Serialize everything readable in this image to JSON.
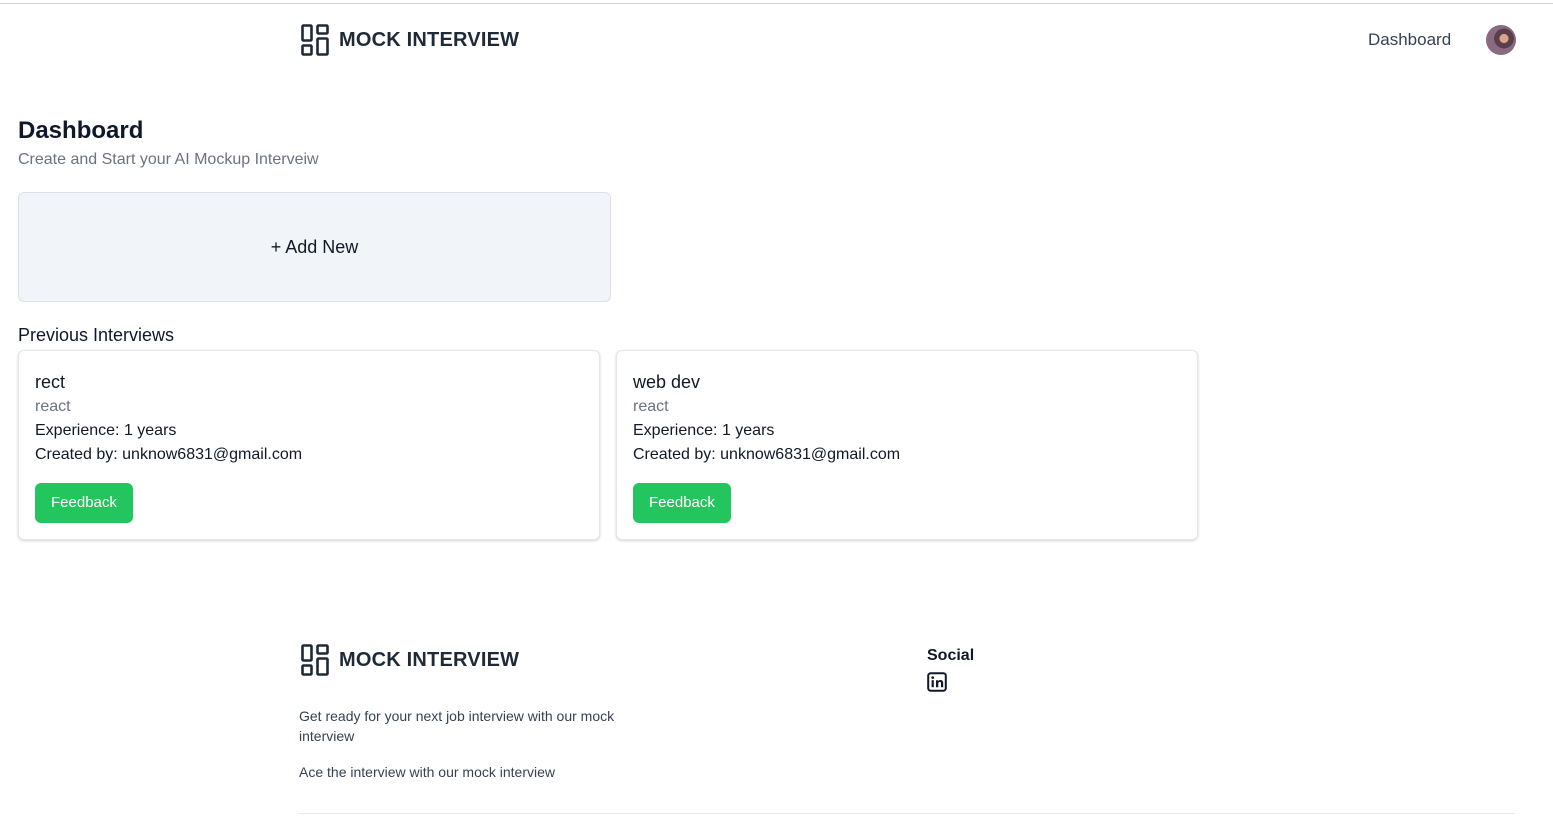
{
  "header": {
    "brand": "MOCK INTERVIEW",
    "nav_dashboard": "Dashboard",
    "logo_icon": "layout-dashboard-icon",
    "avatar_icon": "user-avatar"
  },
  "main": {
    "title": "Dashboard",
    "subtitle": "Create and Start your AI Mockup Interveiw",
    "add_new_label": "+ Add New",
    "previous_title": "Previous Interviews",
    "interviews": [
      {
        "title": "rect",
        "role": "react",
        "experience": "Experience: 1 years",
        "created_by": "Created by: unknow6831@gmail.com",
        "feedback_label": "Feedback"
      },
      {
        "title": "web dev",
        "role": "react",
        "experience": "Experience: 1 years",
        "created_by": "Created by: unknow6831@gmail.com",
        "feedback_label": "Feedback"
      }
    ]
  },
  "footer": {
    "brand": "MOCK INTERVIEW",
    "tagline": "Get ready for your next job interview with our mock interview",
    "tagline2": "Ace the interview with our mock interview",
    "social_heading": "Social",
    "social_icon": "linkedin-icon"
  },
  "colors": {
    "accent_green": "#22c55e",
    "card_bg": "#f1f4f8",
    "muted_text": "#6b7280"
  }
}
